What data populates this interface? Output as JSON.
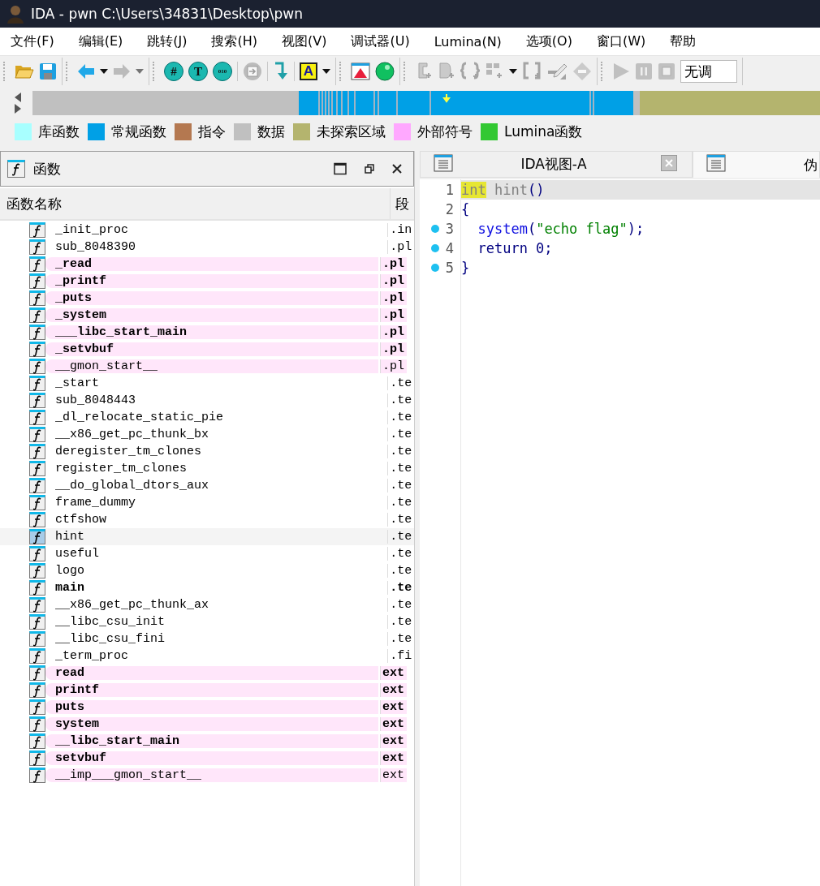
{
  "window": {
    "title": "IDA - pwn C:\\Users\\34831\\Desktop\\pwn"
  },
  "menu": [
    "文件(F)",
    "编辑(E)",
    "跳转(J)",
    "搜索(H)",
    "视图(V)",
    "调试器(U)",
    "Lumina(N)",
    "选项(O)",
    "窗口(W)",
    "帮助"
  ],
  "toolbar": [
    [
      {
        "kind": "folder",
        "disabled": false
      },
      {
        "kind": "save",
        "disabled": false
      }
    ],
    [
      {
        "kind": "back",
        "disabled": false
      },
      {
        "kind": "caret",
        "disabled": false
      },
      {
        "kind": "forward",
        "disabled": true
      },
      {
        "kind": "caret",
        "disabled": true
      }
    ],
    [
      {
        "kind": "badge",
        "glyph": "#",
        "disabled": false
      },
      {
        "kind": "badge",
        "glyph": "T",
        "disabled": false
      },
      {
        "kind": "badge",
        "glyph": "010",
        "disabled": false
      },
      {
        "kind": "sep"
      },
      {
        "kind": "jump",
        "disabled": true
      },
      {
        "kind": "sep"
      },
      {
        "kind": "down",
        "disabled": false
      },
      {
        "kind": "sep"
      },
      {
        "kind": "letter",
        "glyph": "A",
        "disabled": false
      },
      {
        "kind": "caret",
        "disabled": false
      }
    ],
    [
      {
        "kind": "window",
        "disabled": false
      },
      {
        "kind": "ball",
        "disabled": false
      }
    ],
    [
      {
        "kind": "code",
        "disabled": true
      },
      {
        "kind": "data",
        "disabled": true
      },
      {
        "kind": "struct",
        "disabled": true
      },
      {
        "kind": "grid",
        "disabled": true
      },
      {
        "kind": "caret",
        "disabled": false
      },
      {
        "kind": "array",
        "disabled": true
      },
      {
        "kind": "pencil",
        "disabled": true
      },
      {
        "kind": "diamond",
        "disabled": true
      }
    ],
    [
      {
        "kind": "play",
        "disabled": true
      },
      {
        "kind": "pause",
        "disabled": true
      },
      {
        "kind": "stop",
        "disabled": true
      },
      {
        "kind": "select",
        "value": "无调"
      }
    ]
  ],
  "legend": [
    {
      "label": "库函数",
      "color": "#a8ffff"
    },
    {
      "label": "常规函数",
      "color": "#00a0e6"
    },
    {
      "label": "指令",
      "color": "#b47850"
    },
    {
      "label": "数据",
      "color": "#c0c0c0"
    },
    {
      "label": "未探索区域",
      "color": "#b4b46e"
    },
    {
      "label": "外部符号",
      "color": "#ffa8ff"
    },
    {
      "label": "Lumina函数",
      "color": "#32c832"
    }
  ],
  "functions_panel": {
    "title": "函数",
    "columns": [
      "函数名称",
      "段"
    ],
    "rows": [
      {
        "name": "_init_proc",
        "segment": ".in",
        "bold": false,
        "imported": false,
        "selected": false
      },
      {
        "name": "sub_8048390",
        "segment": ".pl",
        "bold": false,
        "imported": false,
        "selected": false
      },
      {
        "name": "_read",
        "segment": ".pl",
        "bold": true,
        "imported": true,
        "selected": false
      },
      {
        "name": "_printf",
        "segment": ".pl",
        "bold": true,
        "imported": true,
        "selected": false
      },
      {
        "name": "_puts",
        "segment": ".pl",
        "bold": true,
        "imported": true,
        "selected": false
      },
      {
        "name": "_system",
        "segment": ".pl",
        "bold": true,
        "imported": true,
        "selected": false
      },
      {
        "name": "___libc_start_main",
        "segment": ".pl",
        "bold": true,
        "imported": true,
        "selected": false
      },
      {
        "name": "_setvbuf",
        "segment": ".pl",
        "bold": true,
        "imported": true,
        "selected": false
      },
      {
        "name": "__gmon_start__",
        "segment": ".pl",
        "bold": false,
        "imported": true,
        "selected": false
      },
      {
        "name": "_start",
        "segment": ".te",
        "bold": false,
        "imported": false,
        "selected": false
      },
      {
        "name": "sub_8048443",
        "segment": ".te",
        "bold": false,
        "imported": false,
        "selected": false
      },
      {
        "name": "_dl_relocate_static_pie",
        "segment": ".te",
        "bold": false,
        "imported": false,
        "selected": false
      },
      {
        "name": "__x86_get_pc_thunk_bx",
        "segment": ".te",
        "bold": false,
        "imported": false,
        "selected": false
      },
      {
        "name": "deregister_tm_clones",
        "segment": ".te",
        "bold": false,
        "imported": false,
        "selected": false
      },
      {
        "name": "register_tm_clones",
        "segment": ".te",
        "bold": false,
        "imported": false,
        "selected": false
      },
      {
        "name": "__do_global_dtors_aux",
        "segment": ".te",
        "bold": false,
        "imported": false,
        "selected": false
      },
      {
        "name": "frame_dummy",
        "segment": ".te",
        "bold": false,
        "imported": false,
        "selected": false
      },
      {
        "name": "ctfshow",
        "segment": ".te",
        "bold": false,
        "imported": false,
        "selected": false
      },
      {
        "name": "hint",
        "segment": ".te",
        "bold": false,
        "imported": false,
        "selected": true
      },
      {
        "name": "useful",
        "segment": ".te",
        "bold": false,
        "imported": false,
        "selected": false
      },
      {
        "name": "logo",
        "segment": ".te",
        "bold": false,
        "imported": false,
        "selected": false
      },
      {
        "name": "main",
        "segment": ".te",
        "bold": true,
        "imported": false,
        "selected": false
      },
      {
        "name": "__x86_get_pc_thunk_ax",
        "segment": ".te",
        "bold": false,
        "imported": false,
        "selected": false
      },
      {
        "name": "__libc_csu_init",
        "segment": ".te",
        "bold": false,
        "imported": false,
        "selected": false
      },
      {
        "name": "__libc_csu_fini",
        "segment": ".te",
        "bold": false,
        "imported": false,
        "selected": false
      },
      {
        "name": "_term_proc",
        "segment": ".fi",
        "bold": false,
        "imported": false,
        "selected": false
      },
      {
        "name": "read",
        "segment": "ext",
        "bold": true,
        "imported": true,
        "selected": false
      },
      {
        "name": "printf",
        "segment": "ext",
        "bold": true,
        "imported": true,
        "selected": false
      },
      {
        "name": "puts",
        "segment": "ext",
        "bold": true,
        "imported": true,
        "selected": false
      },
      {
        "name": "system",
        "segment": "ext",
        "bold": true,
        "imported": true,
        "selected": false
      },
      {
        "name": "__libc_start_main",
        "segment": "ext",
        "bold": true,
        "imported": true,
        "selected": false
      },
      {
        "name": "setvbuf",
        "segment": "ext",
        "bold": true,
        "imported": true,
        "selected": false
      },
      {
        "name": "__imp___gmon_start__",
        "segment": "ext",
        "bold": false,
        "imported": true,
        "selected": false
      }
    ]
  },
  "tabs": [
    {
      "label": "IDA视图-A",
      "selected": false,
      "closable": true
    },
    {
      "label": "伪",
      "selected": true,
      "closable": false
    }
  ],
  "code": [
    {
      "number": "1",
      "breakpoint": false,
      "current": true,
      "tokens": [
        {
          "text": "int",
          "kind": "match"
        },
        {
          "text": " hint",
          "kind": "name"
        },
        {
          "text": "()",
          "kind": "punct"
        }
      ]
    },
    {
      "number": "2",
      "breakpoint": false,
      "current": false,
      "tokens": [
        {
          "text": "{",
          "kind": "punct"
        }
      ]
    },
    {
      "number": "3",
      "breakpoint": true,
      "current": false,
      "tokens": [
        {
          "text": "  system",
          "kind": "func"
        },
        {
          "text": "(",
          "kind": "punct"
        },
        {
          "text": "\"echo flag\"",
          "kind": "string"
        },
        {
          "text": ");",
          "kind": "punct"
        }
      ]
    },
    {
      "number": "4",
      "breakpoint": true,
      "current": false,
      "tokens": [
        {
          "text": "  return 0;",
          "kind": "punct"
        }
      ]
    },
    {
      "number": "5",
      "breakpoint": true,
      "current": false,
      "tokens": [
        {
          "text": "}",
          "kind": "punct"
        }
      ]
    }
  ]
}
